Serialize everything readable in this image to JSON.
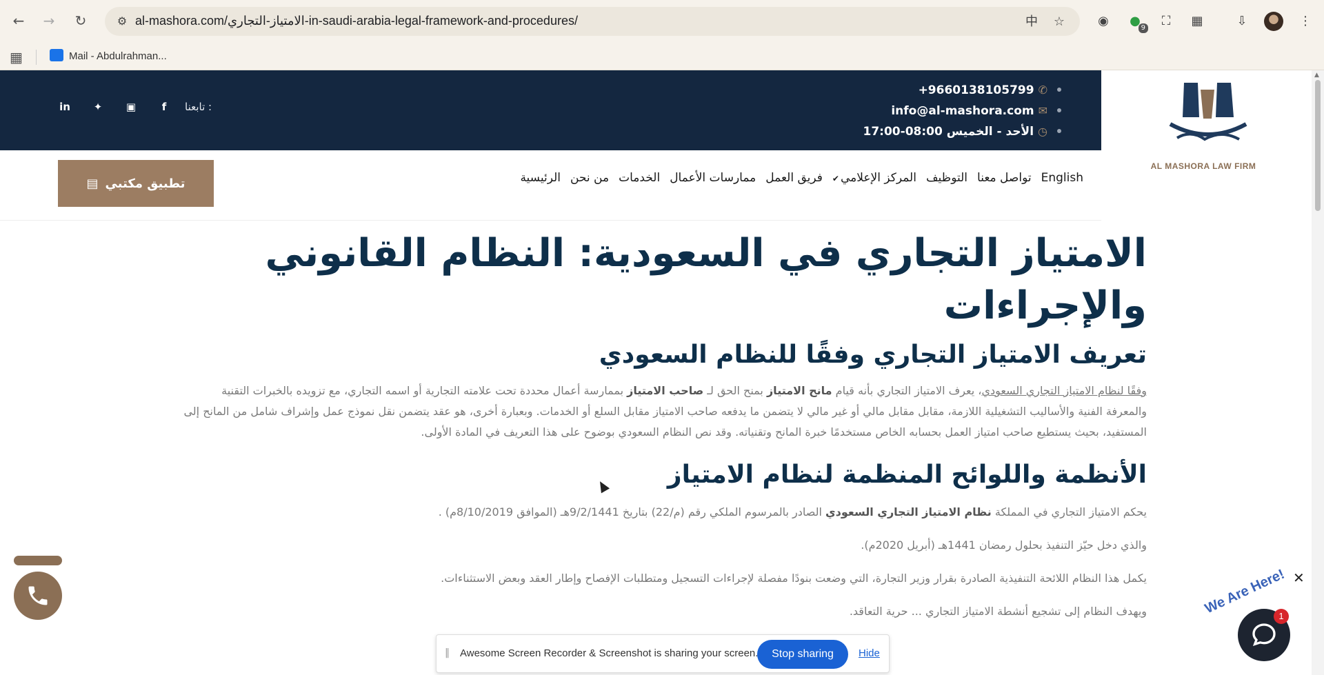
{
  "browser": {
    "url": "al-mashora.com/الامتياز-التجاري-in-saudi-arabia-legal-framework-and-procedures/",
    "extension_badge": "9",
    "bookmark": "Mail - Abdulrahman..."
  },
  "topbar": {
    "phone": "+9660138105799",
    "email": "info@al-mashora.com",
    "hours": "الأحد - الخميس 08:00-17:00",
    "follow_label": "تابعنا :",
    "logo_latin": "AL MASHORA LAW FIRM"
  },
  "nav": {
    "items": [
      "الرئيسية",
      "من نحن",
      "الخدمات",
      "ممارسات الأعمال",
      "فريق العمل",
      "المركز الإعلامي",
      "التوظيف",
      "تواصل معنا",
      "English"
    ],
    "cta": "تطبيق مكتبي"
  },
  "article": {
    "title": "الامتياز التجاري في السعودية: النظام القانوني والإجراءات",
    "section1_heading": "تعريف الامتياز التجاري وفقًا للنظام السعودي",
    "section1_link": "وفقًا لنظام الامتياز التجاري السعودي",
    "section1_text_a": "، يعرف الامتياز التجاري بأنه قيام ",
    "section1_bold_a": "مانح الامتياز",
    "section1_text_b": " بمنح الحق لـ ",
    "section1_bold_b": "صاحب الامتياز",
    "section1_text_c": " بممارسة أعمال محددة تحت علامته التجارية أو اسمه التجاري، مع تزويده بالخبرات التقنية والمعرفة الفنية والأساليب التشغيلية اللازمة، مقابل مقابل مالي أو غير مالي لا يتضمن ما يدفعه صاحب الامتياز مقابل السلع أو الخدمات. وبعبارة أخرى، هو عقد يتضمن نقل نموذج عمل وإشراف شامل من المانح إلى المستفيد، بحيث يستطيع صاحب امتياز العمل بحسابه الخاص مستخدمًا خبرة المانح وتقنياته. وقد نص النظام السعودي بوضوح على هذا التعريف في المادة الأولى.",
    "section2_heading": "الأنظمة واللوائح المنظمة لنظام الامتياز",
    "para2_text_a": "يحكم الامتياز التجاري في المملكة ",
    "para2_bold": "نظام الامتياز التجاري السعودي",
    "para2_text_b": " الصادر بالمرسوم الملكي رقم (م/22) بتاريخ 9/2/1441هـ (الموافق 8/10/2019م) .",
    "para3": "والذي دخل حيّز التنفيذ بحلول رمضان 1441هـ (أبريل 2020م).",
    "para4": "يكمل هذا النظام اللائحة التنفيذية الصادرة بقرار وزير التجارة، التي وضعت بنودًا مفصلة لإجراءات التسجيل ومتطلبات الإفصاح وإطار العقد وبعض الاستثناءات.",
    "para5": "ويهدف النظام إلى تشجيع أنشطة الامتياز التجاري ... حرية التعاقد."
  },
  "screen_share": {
    "message": "Awesome Screen Recorder & Screenshot is sharing your screen.",
    "stop": "Stop sharing",
    "hide": "Hide"
  },
  "chat": {
    "badge_text": "We Are Here!",
    "count": "1"
  }
}
